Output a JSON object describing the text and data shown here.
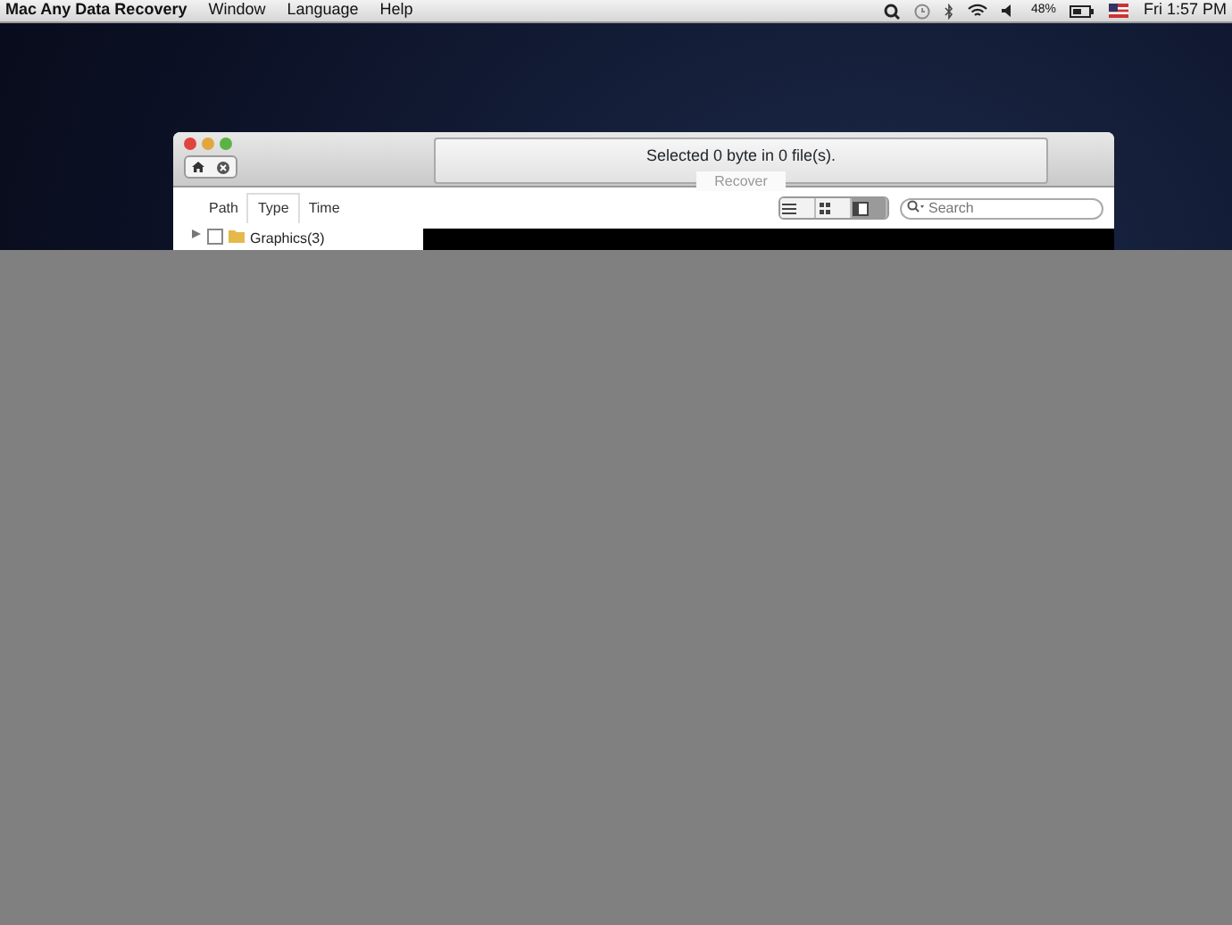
{
  "menu_bar": {
    "app_name": "Mac Any Data Recovery",
    "menus": [
      "Window",
      "Language",
      "Help"
    ],
    "battery_percent": "48%",
    "clock": "Fri 1:57 PM"
  },
  "window": {
    "status": "Selected 0 byte in 0 file(s).",
    "recover_button": {
      "label": "Recover",
      "disabled": true
    },
    "tabs": [
      {
        "label": "Path",
        "selected": false
      },
      {
        "label": "Type",
        "selected": true
      },
      {
        "label": "Time",
        "selected": false
      }
    ],
    "view_modes": [
      {
        "kind": "list",
        "selected": false
      },
      {
        "kind": "grid",
        "selected": false
      },
      {
        "kind": "column",
        "selected": true
      }
    ],
    "search": {
      "placeholder": "Search"
    },
    "tree": [
      {
        "label": "Graphics(3)",
        "checked": false
      }
    ]
  }
}
